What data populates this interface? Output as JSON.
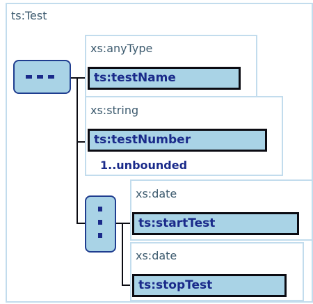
{
  "complex_type": {
    "name": "ts:Test"
  },
  "sequence_compositor": {
    "icon": "sequence-icon"
  },
  "choice_compositor": {
    "icon": "choice-icon"
  },
  "elements": [
    {
      "type": "xs:anyType",
      "name": "ts:testName"
    },
    {
      "type": "xs:string",
      "name": "ts:testNumber",
      "occurrence": "1..unbounded"
    },
    {
      "type": "xs:date",
      "name": "ts:startTest"
    },
    {
      "type": "xs:date",
      "name": "ts:stopTest"
    }
  ]
}
